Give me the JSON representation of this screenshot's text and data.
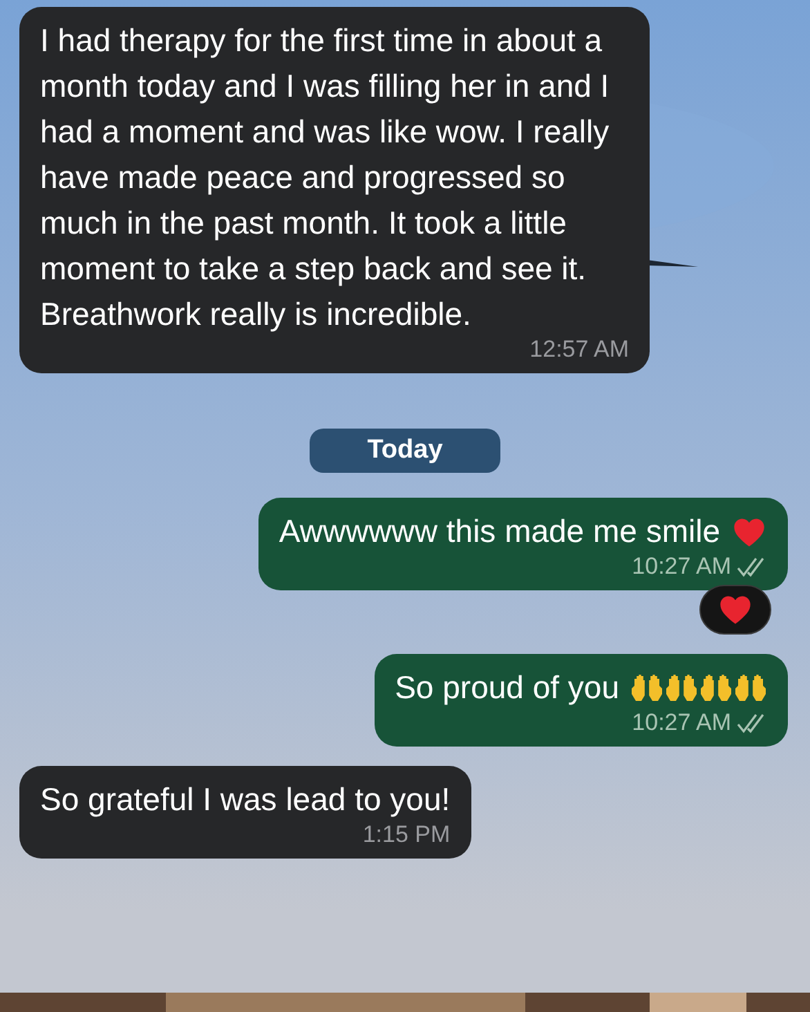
{
  "messages": [
    {
      "kind": "incoming",
      "text": "I had therapy for the first time in about a month today and I was filling her in and I had a moment and was like wow. I really have made peace and progressed so much in the past month. It took a little moment to take a step back and see it. Breathwork really is incredible.",
      "time": "12:57 AM"
    },
    {
      "kind": "date",
      "text": "Today"
    },
    {
      "kind": "outgoing",
      "text": "Awwwwww this made me smile",
      "trailing_icons": [
        {
          "kind": "heart"
        }
      ],
      "time": "10:27 AM",
      "read": true,
      "reaction": {
        "kind": "heart"
      }
    },
    {
      "kind": "outgoing",
      "text": "So proud of you",
      "trailing_icons": [
        {
          "kind": "raised-hands"
        },
        {
          "kind": "raised-hands"
        },
        {
          "kind": "raised-hands"
        },
        {
          "kind": "raised-hands"
        }
      ],
      "time": "10:27 AM",
      "read": true
    },
    {
      "kind": "incoming",
      "text": "So grateful I was lead to you!",
      "time": "1:15 PM"
    }
  ]
}
